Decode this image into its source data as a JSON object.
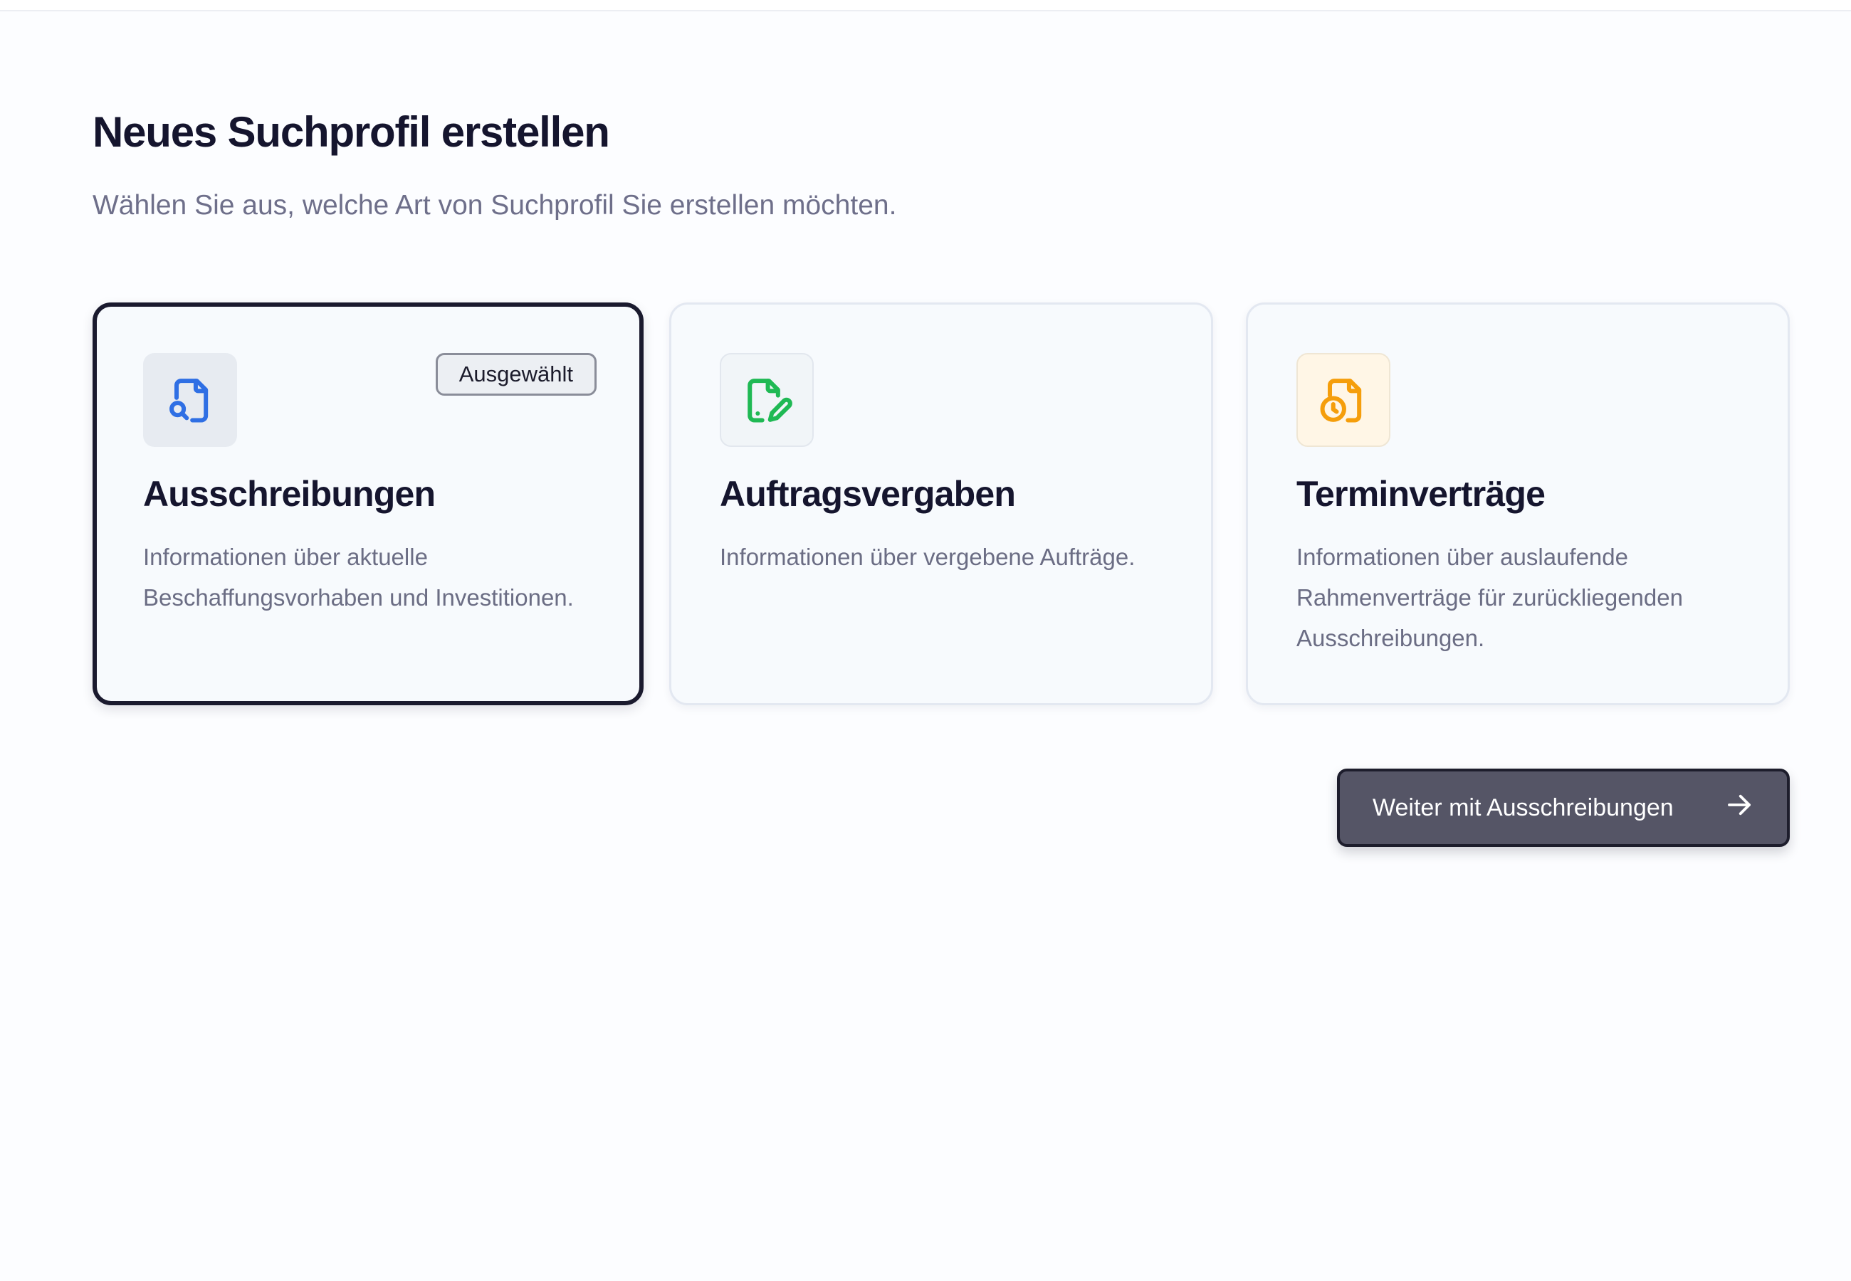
{
  "header": {
    "title": "Neues Suchprofil erstellen",
    "subtitle": "Wählen Sie aus, welche Art von Suchprofil Sie erstellen möchten."
  },
  "cards": [
    {
      "title": "Ausschreibungen",
      "description": "Informationen über aktuelle Beschaffungsvorhaben und Investitionen.",
      "icon": "file-search-icon",
      "icon_color": "#2f6fe4",
      "selected": true,
      "badge": "Ausgewählt"
    },
    {
      "title": "Auftragsvergaben",
      "description": "Informationen über vergebene Aufträge.",
      "icon": "file-edit-icon",
      "icon_color": "#1fb954",
      "selected": false
    },
    {
      "title": "Terminverträge",
      "description": "Informationen über auslaufende Rahmenverträge für zurückliegenden Ausschreibungen.",
      "icon": "file-clock-icon",
      "icon_color": "#f59e0b",
      "selected": false
    }
  ],
  "continue_button": {
    "label": "Weiter mit Ausschreibungen",
    "icon": "arrow-right-icon"
  },
  "colors": {
    "primary_dark": "#1a1a2e",
    "button_bg": "#555566",
    "muted_text": "#6b6d84"
  }
}
